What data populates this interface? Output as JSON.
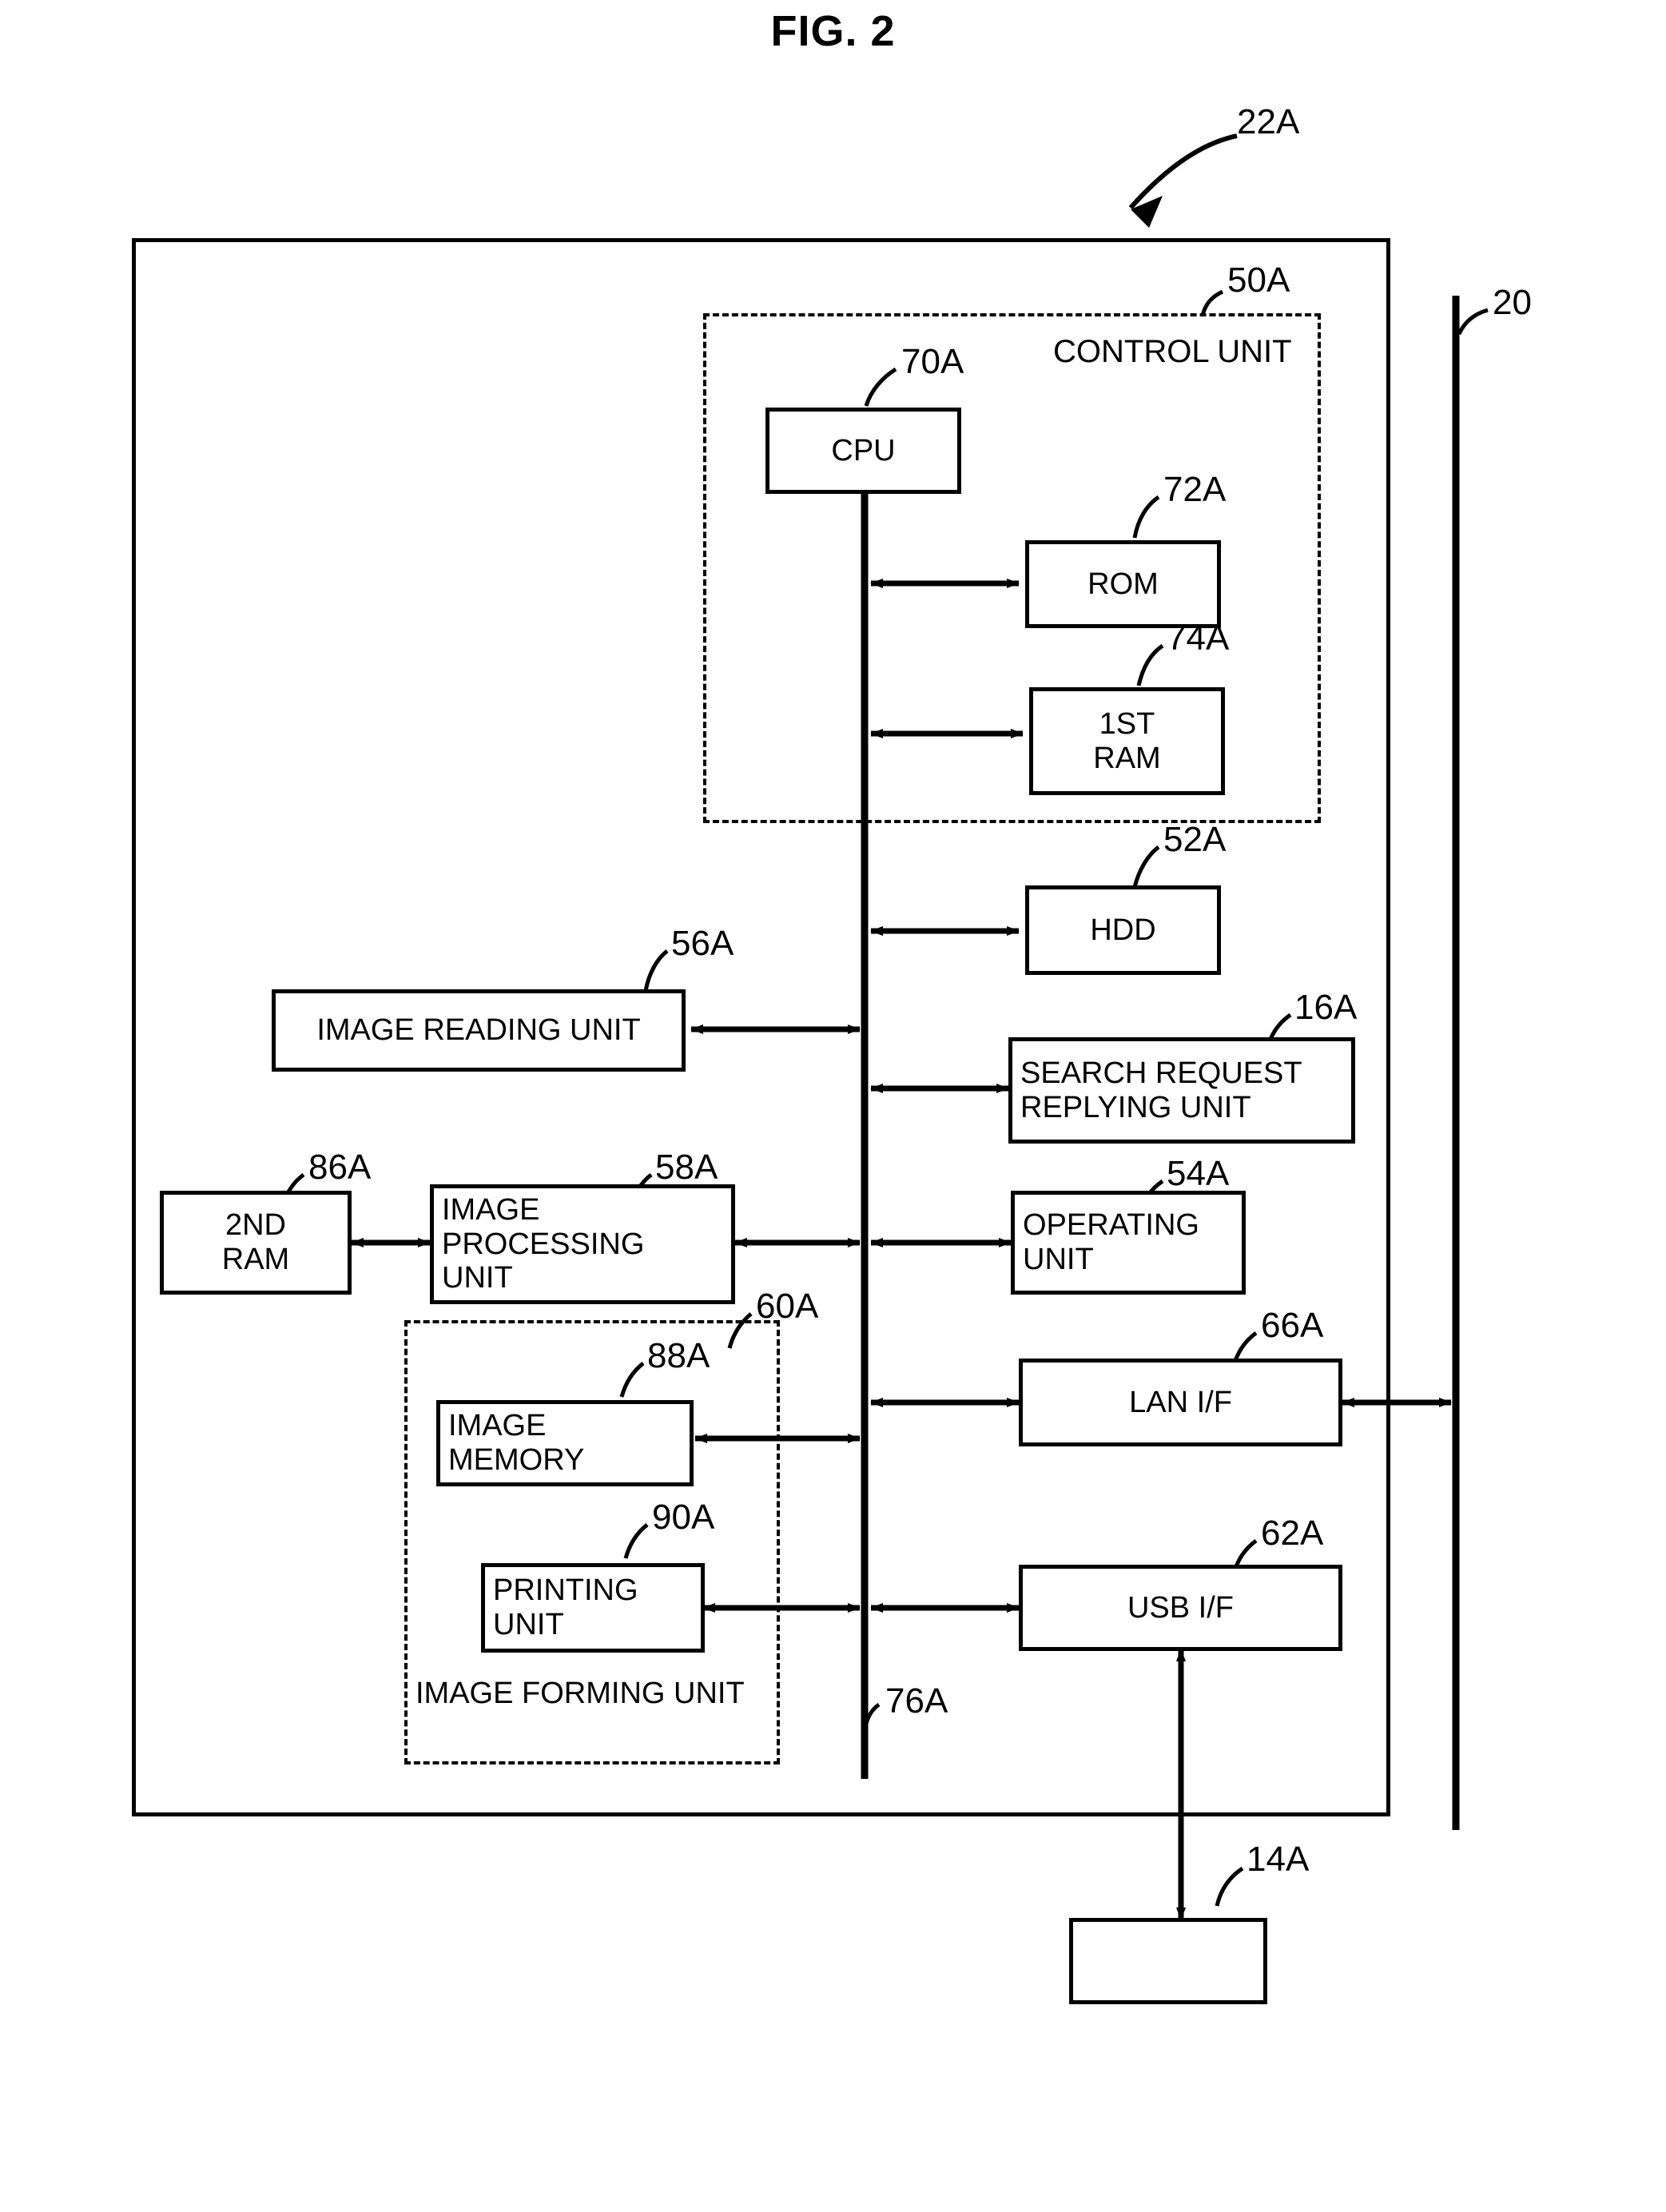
{
  "figure": {
    "title": "FIG. 2"
  },
  "refs": {
    "device": "22A",
    "network_line": "20",
    "control_unit": "50A",
    "cpu": "70A",
    "rom": "72A",
    "first_ram": "74A",
    "hdd": "52A",
    "image_reading_unit": "56A",
    "search_request_replying_unit": "16A",
    "second_ram": "86A",
    "image_processing_unit": "58A",
    "operating_unit": "54A",
    "image_forming_unit": "60A",
    "image_memory": "88A",
    "printing_unit": "90A",
    "lan_if": "66A",
    "usb_if": "62A",
    "bus": "76A",
    "external_device": "14A"
  },
  "blocks": {
    "control_unit_label": "CONTROL UNIT",
    "cpu": "CPU",
    "rom": "ROM",
    "first_ram_line1": "1ST",
    "first_ram_line2": "RAM",
    "hdd": "HDD",
    "image_reading_unit": "IMAGE READING UNIT",
    "search_request_replying_unit_line1": "SEARCH REQUEST",
    "search_request_replying_unit_line2": "REPLYING UNIT",
    "second_ram_line1": "2ND",
    "second_ram_line2": "RAM",
    "image_processing_unit_line1": "IMAGE",
    "image_processing_unit_line2": "PROCESSING",
    "image_processing_unit_line3": "UNIT",
    "operating_unit_line1": "OPERATING",
    "operating_unit_line2": "UNIT",
    "image_memory_line1": "IMAGE",
    "image_memory_line2": "MEMORY",
    "printing_unit_line1": "PRINTING",
    "printing_unit_line2": "UNIT",
    "image_forming_unit_label": "IMAGE FORMING UNIT",
    "lan_if": "LAN I/F",
    "usb_if": "USB I/F",
    "external_device": ""
  },
  "colors": {
    "stroke": "#000000",
    "background": "#ffffff"
  }
}
